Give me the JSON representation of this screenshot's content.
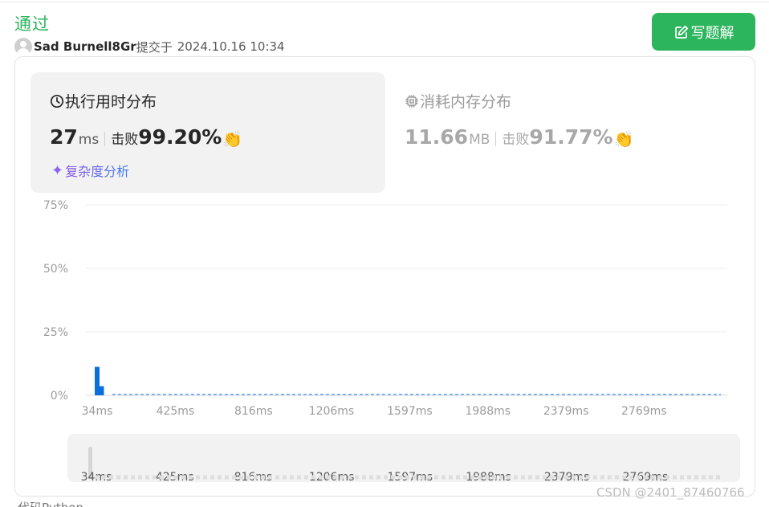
{
  "submission": {
    "status": "通过",
    "username": "Sad Burnell8Gr",
    "submitted_label": "提交于",
    "time": "2024.10.16 10:34"
  },
  "actions": {
    "solution_label": "写题解"
  },
  "runtime": {
    "title": "执行用时分布",
    "value": "27",
    "unit": "ms",
    "beat_label": "击败",
    "beat_value": "99.20%",
    "analysis_label": "复杂度分析"
  },
  "memory": {
    "title": "消耗内存分布",
    "value": "11.66",
    "unit": "MB",
    "beat_label": "击败",
    "beat_value": "91.77%"
  },
  "chart_data": {
    "type": "bar",
    "title": "",
    "xlabel": "",
    "ylabel": "",
    "y_ticks": [
      "75%",
      "50%",
      "25%",
      "0%"
    ],
    "y_tick_values": [
      75,
      50,
      25,
      0
    ],
    "ylim": [
      0,
      75
    ],
    "x_ticks": [
      "34ms",
      "425ms",
      "816ms",
      "1206ms",
      "1597ms",
      "1988ms",
      "2379ms",
      "2769ms"
    ],
    "x_tick_values": [
      34,
      425,
      816,
      1206,
      1597,
      1988,
      2379,
      2769
    ],
    "xlim": [
      34,
      3160
    ],
    "series": [
      {
        "x": [
          34,
          56
        ],
        "values": [
          11.2,
          3.6
        ],
        "color": "#0a6fdc"
      }
    ],
    "near_zero_line_color": "#3f8ef5",
    "grid": true,
    "legend": "none"
  },
  "brush": {
    "x_ticks": [
      "34ms",
      "425ms",
      "816ms",
      "1206ms",
      "1597ms",
      "1988ms",
      "2379ms",
      "2769ms"
    ]
  },
  "footer": {
    "watermark": "CSDN @2401_87460766",
    "code_label": "代码Python"
  },
  "colors": {
    "accent": "#2cb55d",
    "bar": "#0a6fdc",
    "muted": "#9b9b9b"
  },
  "icons": {
    "clock": "clock-icon",
    "chip": "chip-icon",
    "edit": "edit-icon",
    "sparkle": "sparkle-icon",
    "hands": "clapping-hands-icon"
  }
}
